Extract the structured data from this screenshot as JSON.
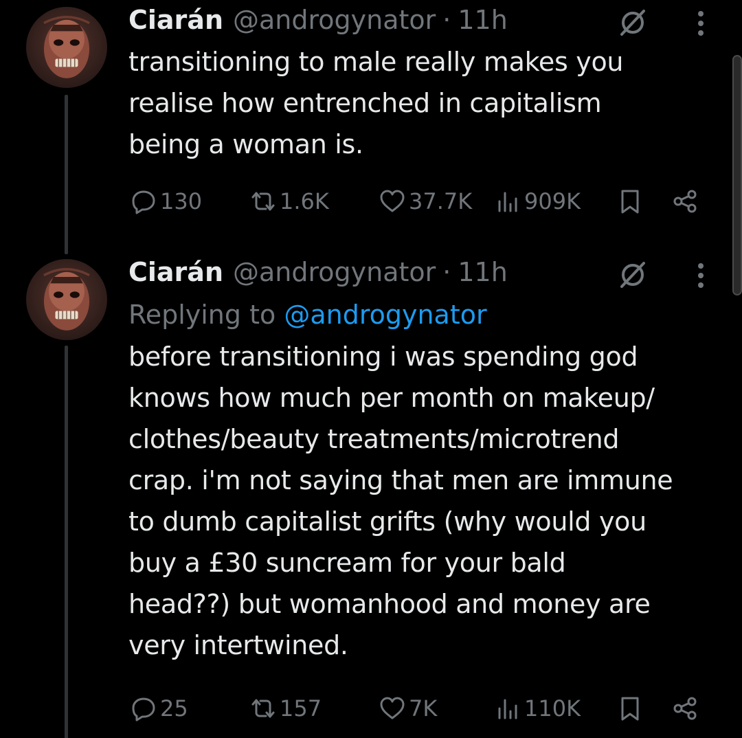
{
  "tweets": [
    {
      "display_name": "Ciarán",
      "handle": "@androgynator",
      "separator": "·",
      "time": "11h",
      "text_lines": [
        "transitioning to male really makes you",
        "realise how entrenched in capitalism",
        "being a woman is."
      ],
      "stats": {
        "replies": "130",
        "reposts": "1.6K",
        "likes": "37.7K",
        "views": "909K"
      }
    },
    {
      "display_name": "Ciarán",
      "handle": "@androgynator",
      "separator": "·",
      "time": "11h",
      "replying_label": "Replying to",
      "replying_to": "@androgynator",
      "text_lines": [
        "before transitioning i was spending god",
        "knows how much per month on makeup/",
        "clothes/beauty treatments/microtrend",
        "crap. i'm not saying that men are immune",
        "to dumb capitalist grifts (why would you",
        "buy a £30 suncream for your bald",
        "head??) but womanhood and money are",
        "very intertwined."
      ],
      "stats": {
        "replies": "25",
        "reposts": "157",
        "likes": "7K",
        "views": "110K"
      }
    }
  ],
  "icons": {
    "reply": "reply-icon",
    "repost": "repost-icon",
    "like": "heart-icon",
    "views": "views-icon",
    "bookmark": "bookmark-icon",
    "share": "share-icon",
    "grok": "grok-icon",
    "more": "more-icon"
  },
  "colors": {
    "background": "#000000",
    "text": "#e7e9ea",
    "muted": "#71767b",
    "link": "#1d9bf0",
    "thread_line": "#2f3336"
  }
}
